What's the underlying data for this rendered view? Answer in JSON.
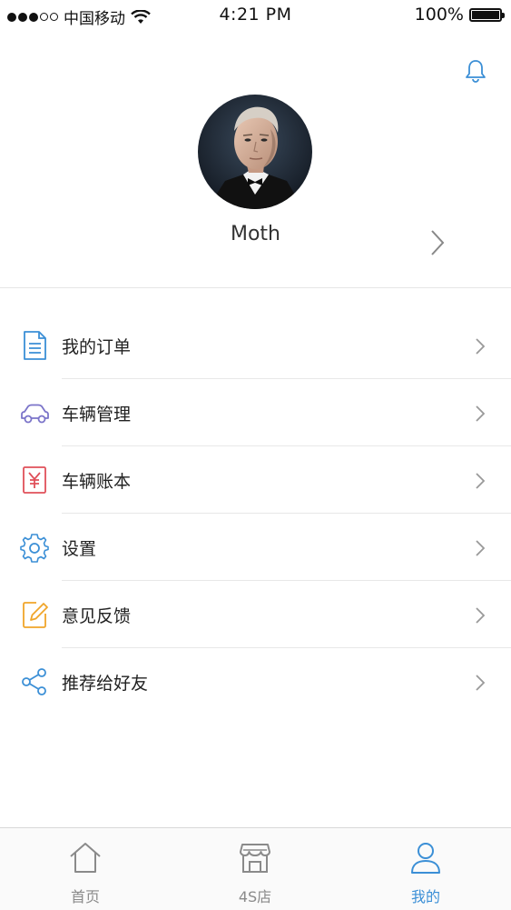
{
  "status_bar": {
    "carrier": "中国移动",
    "time": "4:21 PM",
    "battery": "100%"
  },
  "profile": {
    "name": "Moth"
  },
  "menu": {
    "items": [
      {
        "label": "我的订单",
        "icon": "document-icon"
      },
      {
        "label": "车辆管理",
        "icon": "car-icon"
      },
      {
        "label": "车辆账本",
        "icon": "ledger-yen-icon"
      },
      {
        "label": "设置",
        "icon": "gear-icon"
      },
      {
        "label": "意见反馈",
        "icon": "feedback-pencil-icon"
      },
      {
        "label": "推荐给好友",
        "icon": "share-icon"
      }
    ]
  },
  "tabs": [
    {
      "label": "首页",
      "icon": "home-icon",
      "active": false
    },
    {
      "label": "4S店",
      "icon": "store-icon",
      "active": false
    },
    {
      "label": "我的",
      "icon": "user-icon",
      "active": true
    }
  ],
  "colors": {
    "accent_blue": "#3b8fd6",
    "car_purple": "#7b74c9",
    "ledger_red": "#e0505a",
    "feedback_orange": "#f0a52a",
    "divider": "#e8e8e8"
  }
}
